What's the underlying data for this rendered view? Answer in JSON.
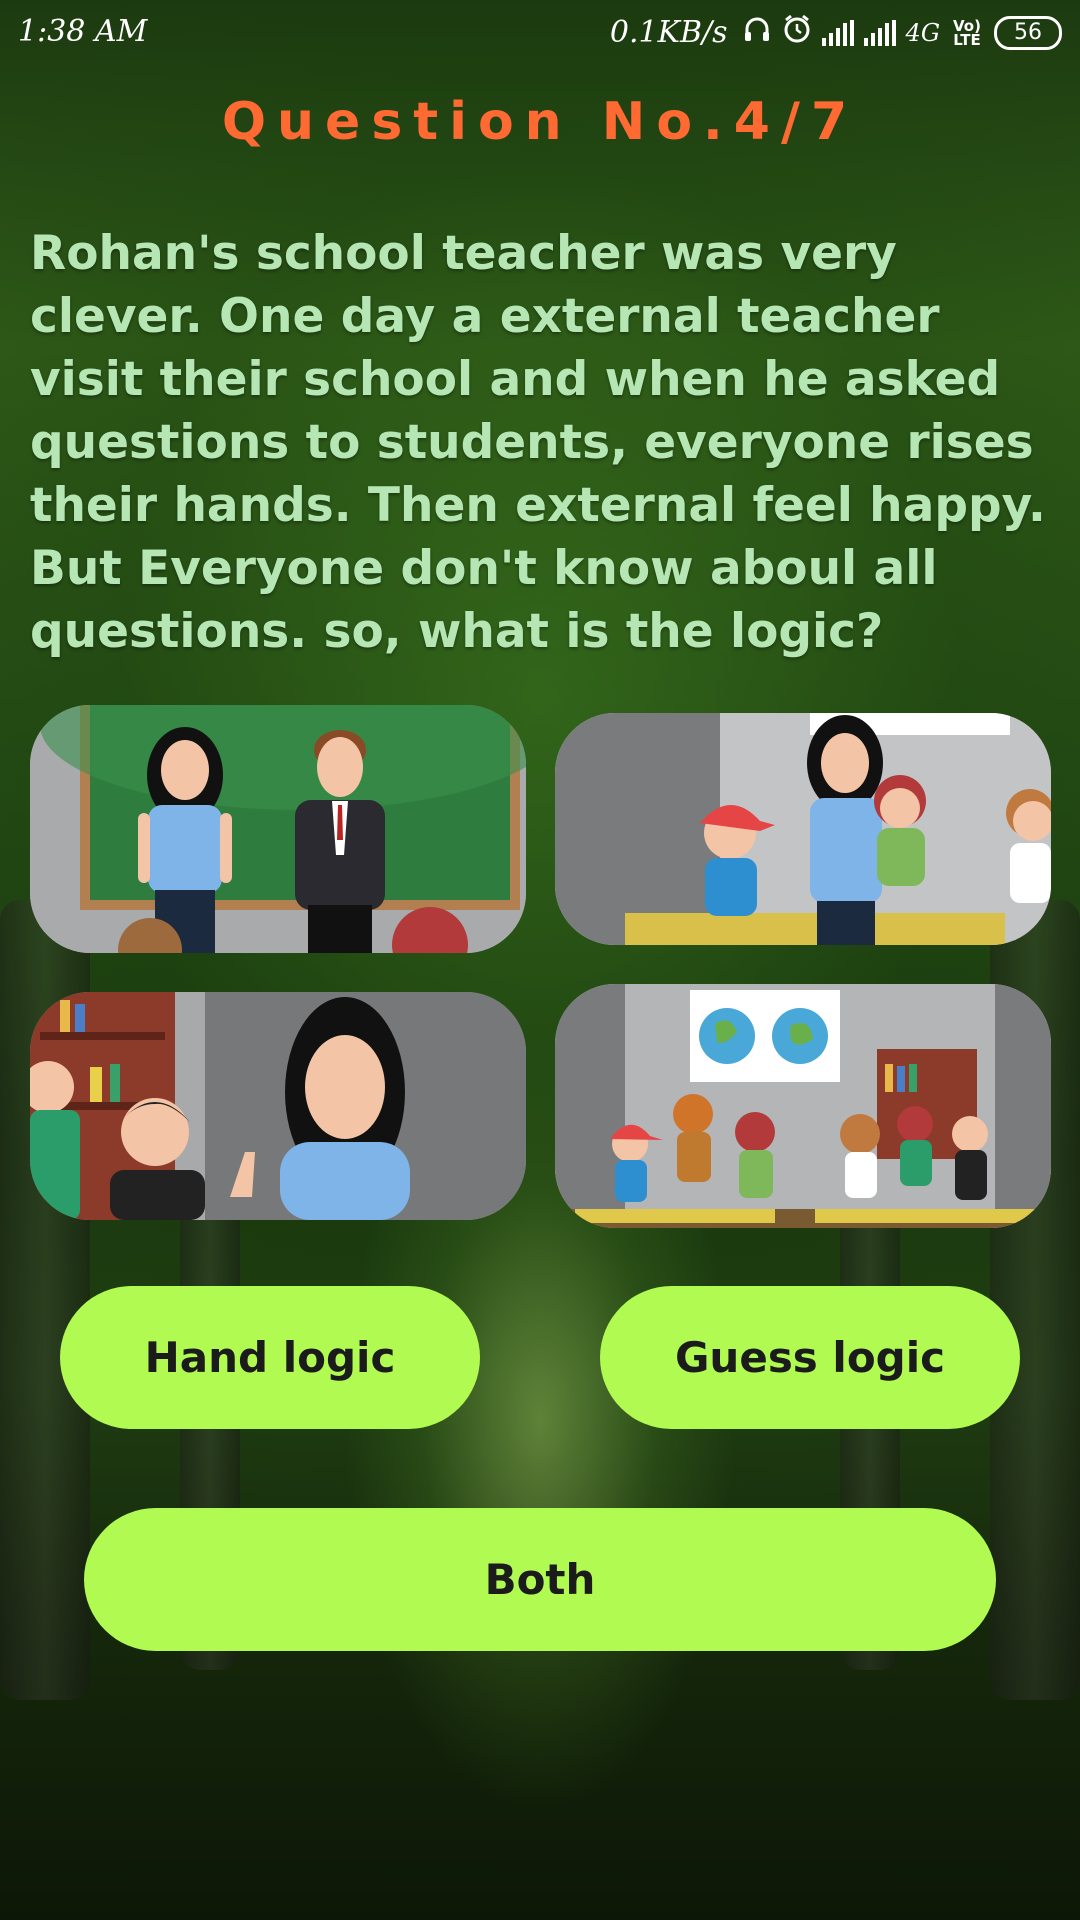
{
  "status_bar": {
    "time": "1:38 AM",
    "network_speed": "0.1KB/s",
    "icons": [
      "headphones-icon",
      "alarm-icon",
      "signal-icon",
      "signal-icon"
    ],
    "network_type": "4G",
    "volte": "Vo) LTE",
    "battery": "56"
  },
  "quiz": {
    "title": "Question No.4/7",
    "question": "Rohan's school teacher was very clever. One day a external teacher visit their school and when he asked questions to students, everyone rises their hands. Then external feel happy. But Everyone don't know aboul all questions. so, what is the logic?"
  },
  "images": [
    {
      "name": "teachers-at-blackboard"
    },
    {
      "name": "teacher-with-students"
    },
    {
      "name": "teacher-with-student-raising-hand"
    },
    {
      "name": "classroom-with-globe-poster"
    }
  ],
  "answers": {
    "option_1": "Hand logic",
    "option_2": "Guess logic",
    "option_3": "Both"
  },
  "colors": {
    "title": "#ff6a33",
    "question_text": "#b5e6b3",
    "answer_button": "#b0fa52",
    "answer_text": "#1b1b1b"
  }
}
